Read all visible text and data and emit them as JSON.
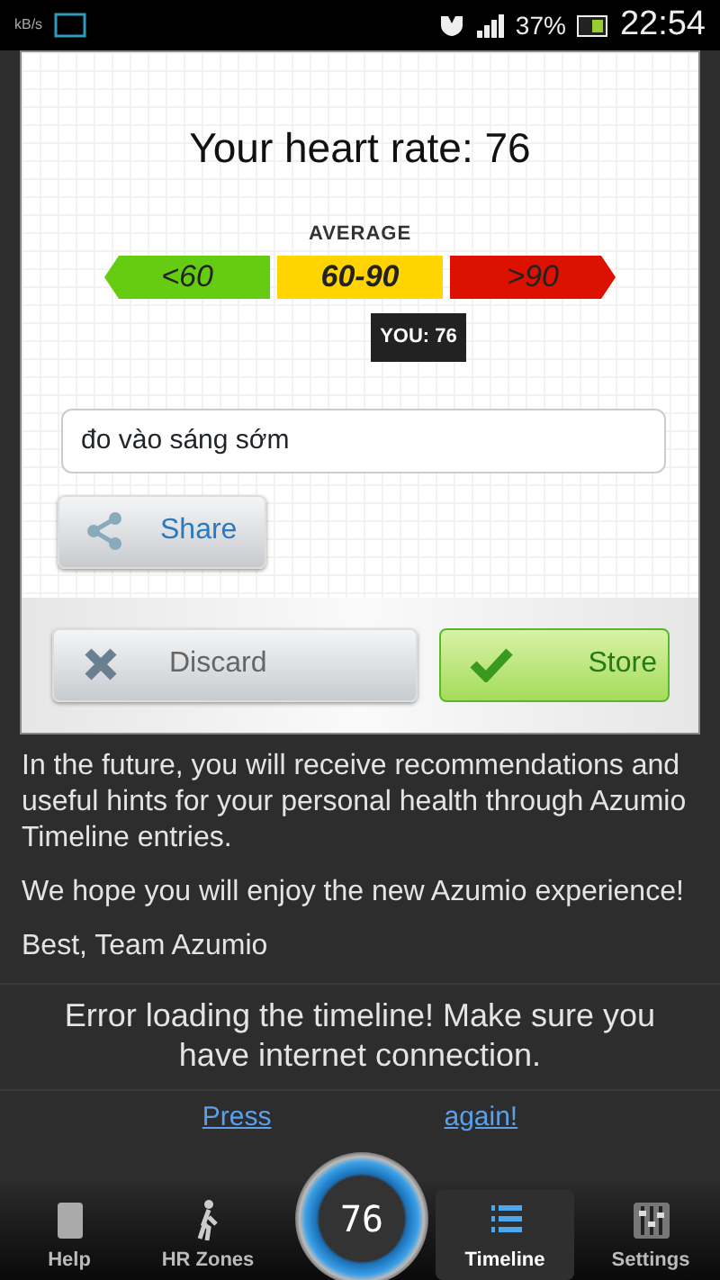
{
  "status_bar": {
    "speed": "kB/s",
    "battery": "37%",
    "time": "22:54"
  },
  "dialog": {
    "title": "Your heart rate: 76",
    "zone_label": "AVERAGE",
    "zones": [
      {
        "label": "<60",
        "color": "#66cc11",
        "selected": false
      },
      {
        "label": "60-90",
        "color": "#ffd400",
        "selected": true
      },
      {
        "label": ">90",
        "color": "#dd1100",
        "selected": false
      }
    ],
    "marker": "YOU: 76",
    "note": {
      "value": "đo vào sáng sớm"
    },
    "share_button": "Share",
    "discard_button": "Discard",
    "store_button": "Store"
  },
  "paragraphs": [
    "In the future, you will receive recommendations and useful hints for your personal health through Azumio Timeline entries.",
    "We hope you will enjoy the new Azumio experience!",
    "Best, Team Azumio"
  ],
  "error": "Error loading the timeline! Make sure you have internet connection.",
  "retry_link": [
    "Press",
    "again!"
  ],
  "heart_widget": {
    "reading": "76"
  },
  "tabs": [
    {
      "label": "Help",
      "selected": false
    },
    {
      "label": "HR Zones",
      "selected": false
    },
    {
      "label": "Timeline",
      "selected": true
    },
    {
      "label": "Settings",
      "selected": false
    }
  ]
}
